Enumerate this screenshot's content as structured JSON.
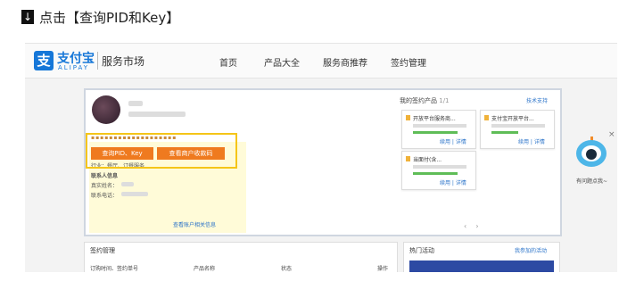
{
  "step": {
    "icon": "down-arrow-icon",
    "text": "点击【查询PID和Key】"
  },
  "header": {
    "logo_text": "支付宝",
    "logo_sub": "ALIPAY",
    "title": "服务市场",
    "nav": [
      "首页",
      "产品大全",
      "服务商推荐",
      "签约管理"
    ]
  },
  "account": {
    "query_button": "查询PID、Key",
    "view_button": "查看商户收款码",
    "industry_label": "行业：餐厅、订餐服务",
    "contact_title": "联系人信息",
    "real_name_label": "真实姓名：",
    "phone_label": "联系电话：",
    "view_info_link": "查看账户相关信息"
  },
  "products": {
    "title": "我的签约产品",
    "count": "1/1",
    "support_link": "技术支持",
    "cards": [
      {
        "name": "开放平台服务商...",
        "date": "2016-02-05 10:47",
        "actions": "续用 | 详情"
      },
      {
        "name": "支付宝开放平台...",
        "date": "2017-06-17 11:38",
        "actions": "续用 | 详情"
      },
      {
        "name": "当面付(含...",
        "date": "2017-06-17 11:38",
        "actions": "续用 | 详情"
      }
    ]
  },
  "sign_mgmt": {
    "title": "签约管理",
    "columns": [
      "订购时间、签约单号",
      "产品名称",
      "状态",
      "操作"
    ]
  },
  "hot": {
    "title": "热门活动",
    "link": "我参加的活动"
  },
  "robot": {
    "caption": "有问题点我~",
    "close": "×"
  },
  "colors": {
    "accent_orange": "#ef7a1f",
    "highlight_yellow": "#f5c518",
    "alipay_blue": "#1677d8"
  }
}
